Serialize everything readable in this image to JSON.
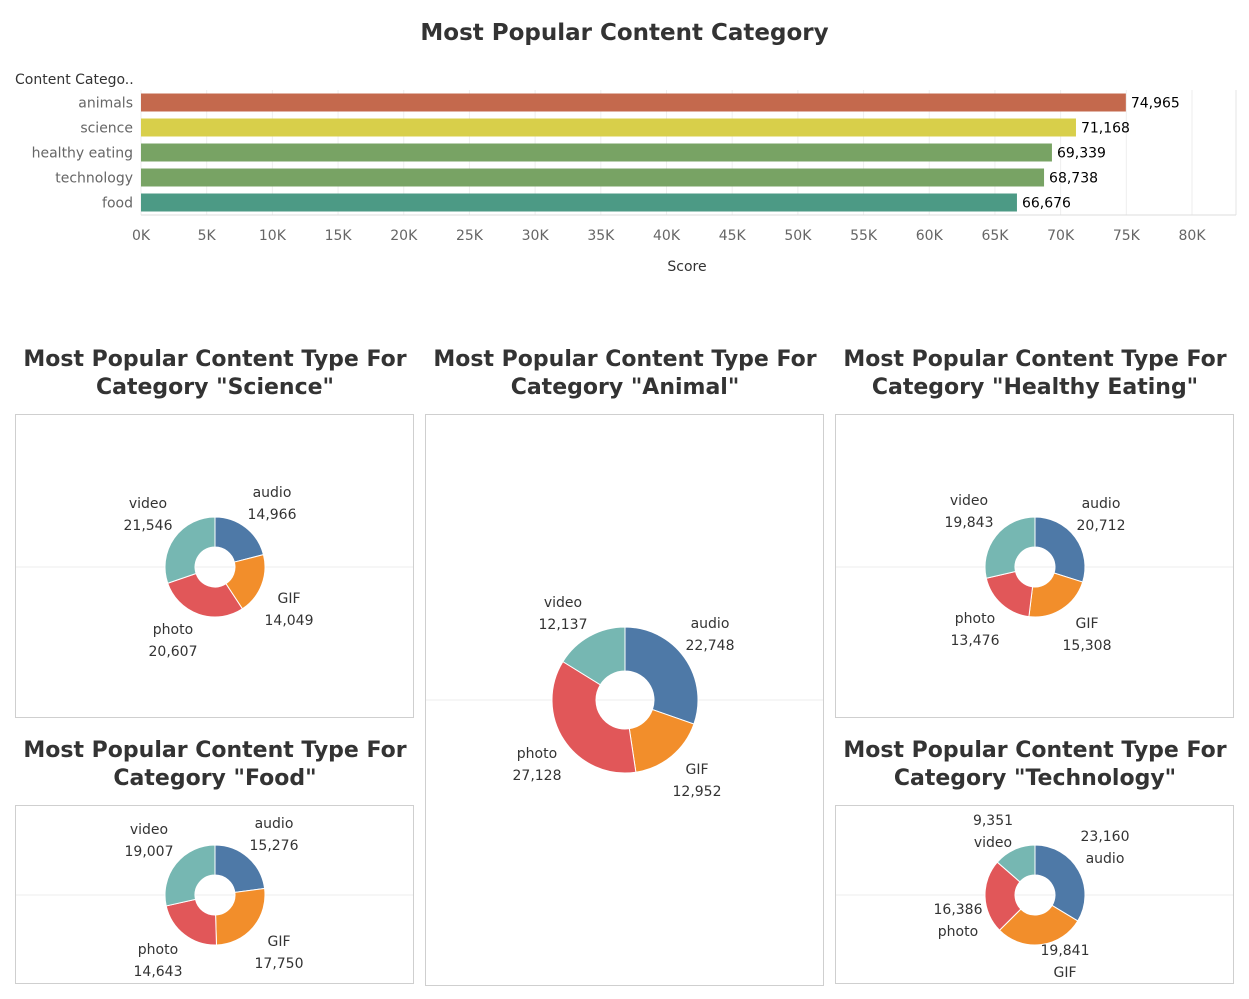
{
  "chart_data": [
    {
      "type": "bar",
      "orientation": "horizontal",
      "title": "Most Popular Content Category",
      "ylabel": "Content Catego..",
      "xlabel": "Score",
      "categories": [
        "animals",
        "science",
        "healthy eating",
        "technology",
        "food"
      ],
      "values": [
        74965,
        71168,
        69339,
        68738,
        66676
      ],
      "value_labels": [
        "74,965",
        "71,168",
        "69,339",
        "68,738",
        "66,676"
      ],
      "colors": [
        "#c4694d",
        "#d8cf4a",
        "#78a364",
        "#78a364",
        "#4c9a85"
      ],
      "xlim": [
        0,
        80000
      ],
      "xticks": [
        "0K",
        "5K",
        "10K",
        "15K",
        "20K",
        "25K",
        "30K",
        "35K",
        "40K",
        "45K",
        "50K",
        "55K",
        "60K",
        "65K",
        "70K",
        "75K",
        "80K"
      ]
    },
    {
      "type": "pie",
      "title_line1": "Most Popular Content Type For",
      "title_line2": "Category \"Science\"",
      "slices": [
        {
          "label": "audio",
          "value": 14966,
          "value_text": "14,966"
        },
        {
          "label": "GIF",
          "value": 14049,
          "value_text": "14,049"
        },
        {
          "label": "photo",
          "value": 20607,
          "value_text": "20,607"
        },
        {
          "label": "video",
          "value": 21546,
          "value_text": "21,546"
        }
      ]
    },
    {
      "type": "pie",
      "title_line1": "Most Popular Content Type For",
      "title_line2": "Category \"Animal\"",
      "slices": [
        {
          "label": "audio",
          "value": 22748,
          "value_text": "22,748"
        },
        {
          "label": "GIF",
          "value": 12952,
          "value_text": "12,952"
        },
        {
          "label": "photo",
          "value": 27128,
          "value_text": "27,128"
        },
        {
          "label": "video",
          "value": 12137,
          "value_text": "12,137"
        }
      ]
    },
    {
      "type": "pie",
      "title_line1": "Most Popular Content Type For",
      "title_line2": "Category \"Healthy Eating\"",
      "slices": [
        {
          "label": "audio",
          "value": 20712,
          "value_text": "20,712"
        },
        {
          "label": "GIF",
          "value": 15308,
          "value_text": "15,308"
        },
        {
          "label": "photo",
          "value": 13476,
          "value_text": "13,476"
        },
        {
          "label": "video",
          "value": 19843,
          "value_text": "19,843"
        }
      ]
    },
    {
      "type": "pie",
      "title_line1": "Most Popular Content Type For",
      "title_line2": "Category \"Food\"",
      "slices": [
        {
          "label": "audio",
          "value": 15276,
          "value_text": "15,276"
        },
        {
          "label": "GIF",
          "value": 17750,
          "value_text": "17,750"
        },
        {
          "label": "photo",
          "value": 14643,
          "value_text": "14,643"
        },
        {
          "label": "video",
          "value": 19007,
          "value_text": "19,007"
        }
      ]
    },
    {
      "type": "pie",
      "title_line1": "Most Popular Content Type For",
      "title_line2": "Category \"Technology\"",
      "slices": [
        {
          "label": "audio",
          "value": 23160,
          "value_text": "23,160"
        },
        {
          "label": "GIF",
          "value": 19841,
          "value_text": "19,841"
        },
        {
          "label": "photo",
          "value": 16386,
          "value_text": "16,386"
        },
        {
          "label": "video",
          "value": 9351,
          "value_text": "9,351"
        }
      ]
    }
  ],
  "pie_colors": {
    "audio": "#4e79a7",
    "GIF": "#f28e2b",
    "photo": "#e15759",
    "video": "#76b7b2"
  }
}
